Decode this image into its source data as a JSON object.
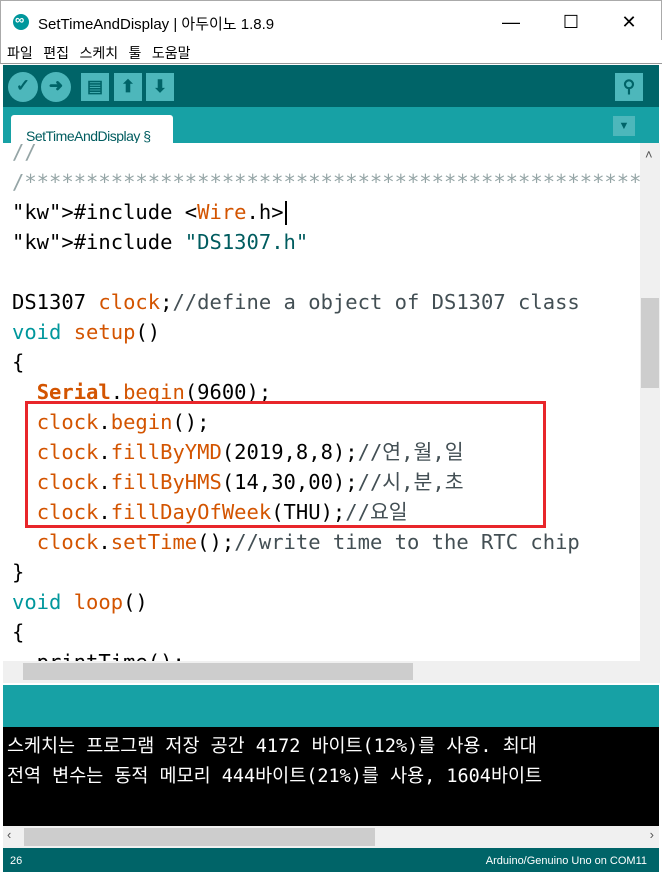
{
  "window": {
    "title": "SetTimeAndDisplay | 아두이노 1.8.9",
    "minimize": "—",
    "maximize": "☐",
    "close": "✕"
  },
  "menu": [
    "파일",
    "편집",
    "스케치",
    "툴",
    "도움말"
  ],
  "toolbar": {
    "verify": "✓",
    "upload": "➜",
    "new": "▤",
    "open": "⬆",
    "save": "⬇",
    "serial_monitor": "⚲"
  },
  "tab": {
    "label": "SetTimeAndDisplay §",
    "menu": "▼"
  },
  "code": [
    "//",
    "/****************************************************",
    "#include <Wire.h>",
    "#include \"DS1307.h\"",
    "",
    "DS1307 clock;//define a object of DS1307 class",
    "void setup()",
    "{",
    "  Serial.begin(9600);",
    "  clock.begin();",
    "  clock.fillByYMD(2019,8,8);//연,월,일",
    "  clock.fillByHMS(14,30,00);//시,분,초",
    "  clock.fillDayOfWeek(THU);//요일",
    "  clock.setTime();//write time to the RTC chip",
    "}",
    "void loop()",
    "{",
    "  printTime();"
  ],
  "console": [
    "스케치는 프로그램 저장 공간 4172 바이트(12%)를 사용. 최대",
    "전역 변수는 동적 메모리 444바이트(21%)를 사용, 1604바이트"
  ],
  "status": {
    "line": "26",
    "board": "Arduino/Genuino Uno on COM11"
  },
  "colors": {
    "toolbar": "#006468",
    "tabbar": "#17a1a5",
    "highlight_box": "#e8262a"
  }
}
